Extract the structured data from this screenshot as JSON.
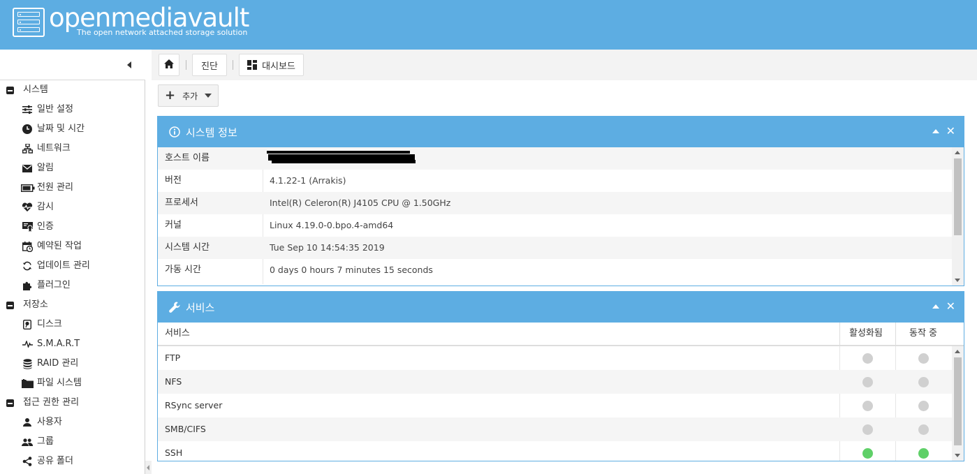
{
  "brand": {
    "title": "openmediavault",
    "subtitle": "The open network attached storage solution"
  },
  "breadcrumb": {
    "items": [
      "진단",
      "대시보드"
    ]
  },
  "toolbar": {
    "add_label": "추가"
  },
  "sidebar": {
    "groups": [
      {
        "label": "시스템",
        "items": [
          {
            "label": "일반 설정",
            "icon": "sliders-icon"
          },
          {
            "label": "날짜 및 시간",
            "icon": "clock-icon"
          },
          {
            "label": "네트워크",
            "icon": "network-icon"
          },
          {
            "label": "알림",
            "icon": "envelope-icon"
          },
          {
            "label": "전원 관리",
            "icon": "battery-icon"
          },
          {
            "label": "감시",
            "icon": "heartbeat-icon"
          },
          {
            "label": "인증",
            "icon": "certificate-icon"
          },
          {
            "label": "예약된 작업",
            "icon": "calendar-clock-icon"
          },
          {
            "label": "업데이트 관리",
            "icon": "refresh-icon"
          },
          {
            "label": "플러그인",
            "icon": "puzzle-icon"
          }
        ]
      },
      {
        "label": "저장소",
        "items": [
          {
            "label": "디스크",
            "icon": "disk-icon"
          },
          {
            "label": "S.M.A.R.T",
            "icon": "pulse-icon"
          },
          {
            "label": "RAID 관리",
            "icon": "database-icon"
          },
          {
            "label": "파일 시스템",
            "icon": "folder-icon"
          }
        ]
      },
      {
        "label": "접근 권한 관리",
        "items": [
          {
            "label": "사용자",
            "icon": "user-icon"
          },
          {
            "label": "그룹",
            "icon": "users-icon"
          },
          {
            "label": "공유 폴더",
            "icon": "share-icon"
          }
        ]
      }
    ]
  },
  "sysinfo": {
    "title": "시스템 정보",
    "rows": [
      {
        "key": "호스트 이름",
        "value": ""
      },
      {
        "key": "버전",
        "value": "4.1.22-1 (Arrakis)"
      },
      {
        "key": "프로세서",
        "value": "Intel(R) Celeron(R) J4105 CPU @ 1.50GHz"
      },
      {
        "key": "커널",
        "value": "Linux 4.19.0-0.bpo.4-amd64"
      },
      {
        "key": "시스템 시간",
        "value": "Tue Sep 10 14:54:35 2019"
      },
      {
        "key": "가동 시간",
        "value": "0 days 0 hours 7 minutes 15 seconds"
      }
    ]
  },
  "services": {
    "title": "서비스",
    "columns": {
      "name": "서비스",
      "enabled": "활성화됨",
      "running": "동작 중"
    },
    "rows": [
      {
        "name": "FTP",
        "enabled": false,
        "running": false
      },
      {
        "name": "NFS",
        "enabled": false,
        "running": false
      },
      {
        "name": "RSync server",
        "enabled": false,
        "running": false
      },
      {
        "name": "SMB/CIFS",
        "enabled": false,
        "running": false
      },
      {
        "name": "SSH",
        "enabled": true,
        "running": true
      }
    ]
  },
  "colors": {
    "accent": "#5dade2",
    "status_on": "#5fd068",
    "status_off": "#d0d0d0"
  }
}
